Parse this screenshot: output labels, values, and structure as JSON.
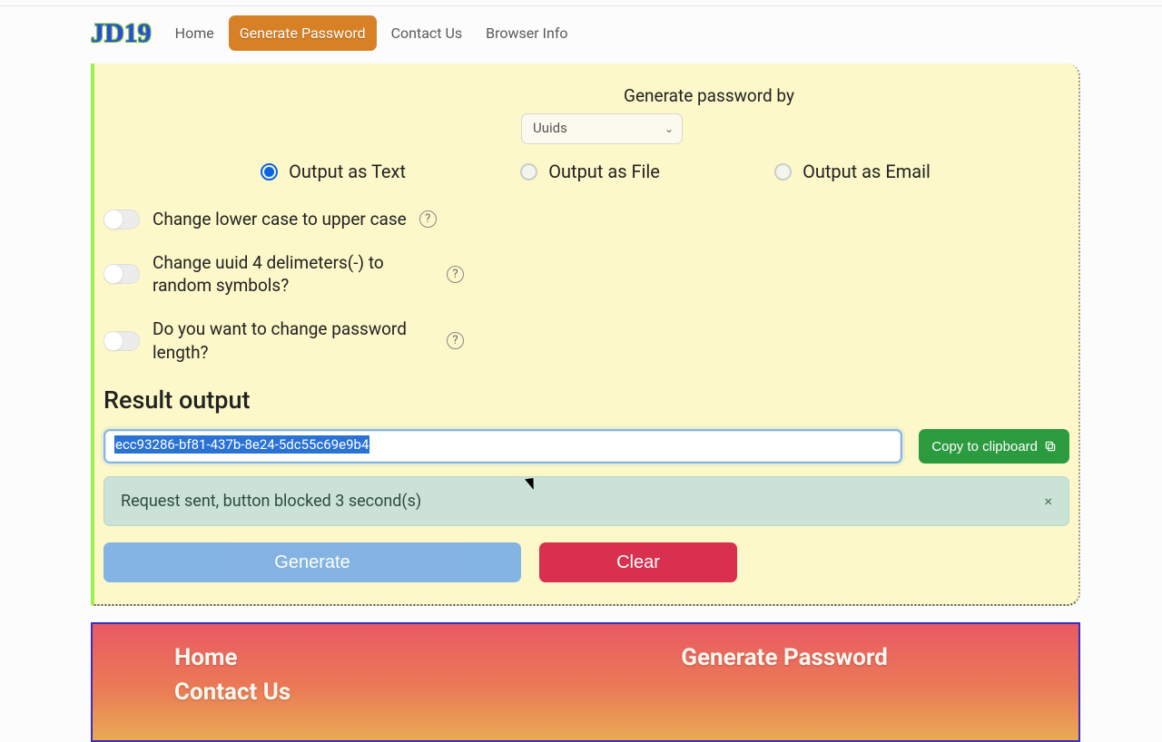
{
  "brand": "JD19",
  "nav": {
    "home": "Home",
    "generate": "Generate Password",
    "contact": "Contact Us",
    "browser": "Browser Info"
  },
  "form": {
    "gen_by_label": "Generate password by",
    "gen_by_value": "Uuids",
    "radios": {
      "text": "Output as Text",
      "file": "Output as File",
      "email": "Output as Email"
    },
    "toggles": {
      "uppercase": "Change lower case to upper case",
      "delimiters": "Change uuid 4 delimeters(-) to random symbols?",
      "length": "Do you want to change password length?"
    }
  },
  "result": {
    "heading": "Result output",
    "value": "ecc93286-bf81-437b-8e24-5dc55c69e9b4",
    "copy_label": "Copy to clipboard"
  },
  "alert": {
    "text": "Request sent, button blocked 3 second(s)",
    "close": "×"
  },
  "buttons": {
    "generate": "Generate",
    "clear": "Clear"
  },
  "footer": {
    "home": "Home",
    "contact": "Contact Us",
    "generate": "Generate Password"
  },
  "help_glyph": "?"
}
